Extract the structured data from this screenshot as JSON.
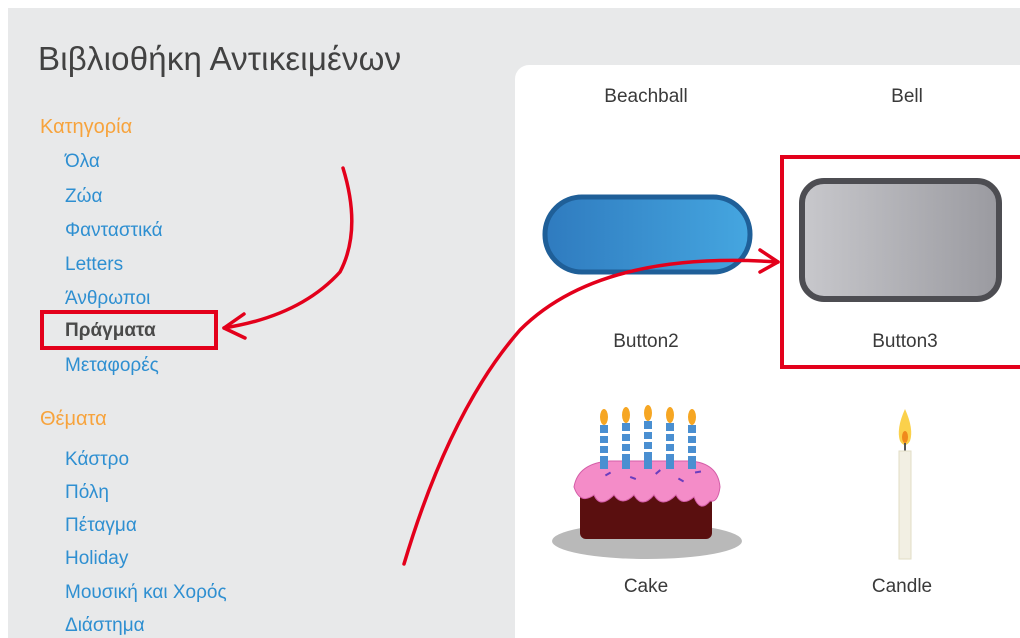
{
  "library": {
    "title": "Βιβλιοθήκη Αντικειμένων"
  },
  "category_section": {
    "heading": "Κατηγορία",
    "items": [
      {
        "label": "Όλα"
      },
      {
        "label": "Ζώα"
      },
      {
        "label": "Φανταστικά"
      },
      {
        "label": "Letters"
      },
      {
        "label": "Άνθρωποι"
      },
      {
        "label": "Πράγματα",
        "selected": true
      },
      {
        "label": "Μεταφορές"
      }
    ]
  },
  "themes_section": {
    "heading": "Θέματα",
    "items": [
      {
        "label": "Κάστρο"
      },
      {
        "label": "Πόλη"
      },
      {
        "label": "Πέταγμα"
      },
      {
        "label": "Holiday"
      },
      {
        "label": "Μουσική και Χορός"
      },
      {
        "label": "Διάστημα"
      }
    ]
  },
  "sprites": [
    {
      "name": "Beachball",
      "icon": "beachball-icon"
    },
    {
      "name": "Bell",
      "icon": "bell-icon"
    },
    {
      "name": "Button2",
      "icon": "blue-pill-button-icon"
    },
    {
      "name": "Button3",
      "icon": "gray-rounded-button-icon",
      "highlighted": true
    },
    {
      "name": "Cake",
      "icon": "birthday-cake-icon"
    },
    {
      "name": "Candle",
      "icon": "candle-icon"
    }
  ],
  "colors": {
    "heading_orange": "#f7a33c",
    "link_blue": "#2e8fd1",
    "annotation_red": "#e3001b"
  }
}
